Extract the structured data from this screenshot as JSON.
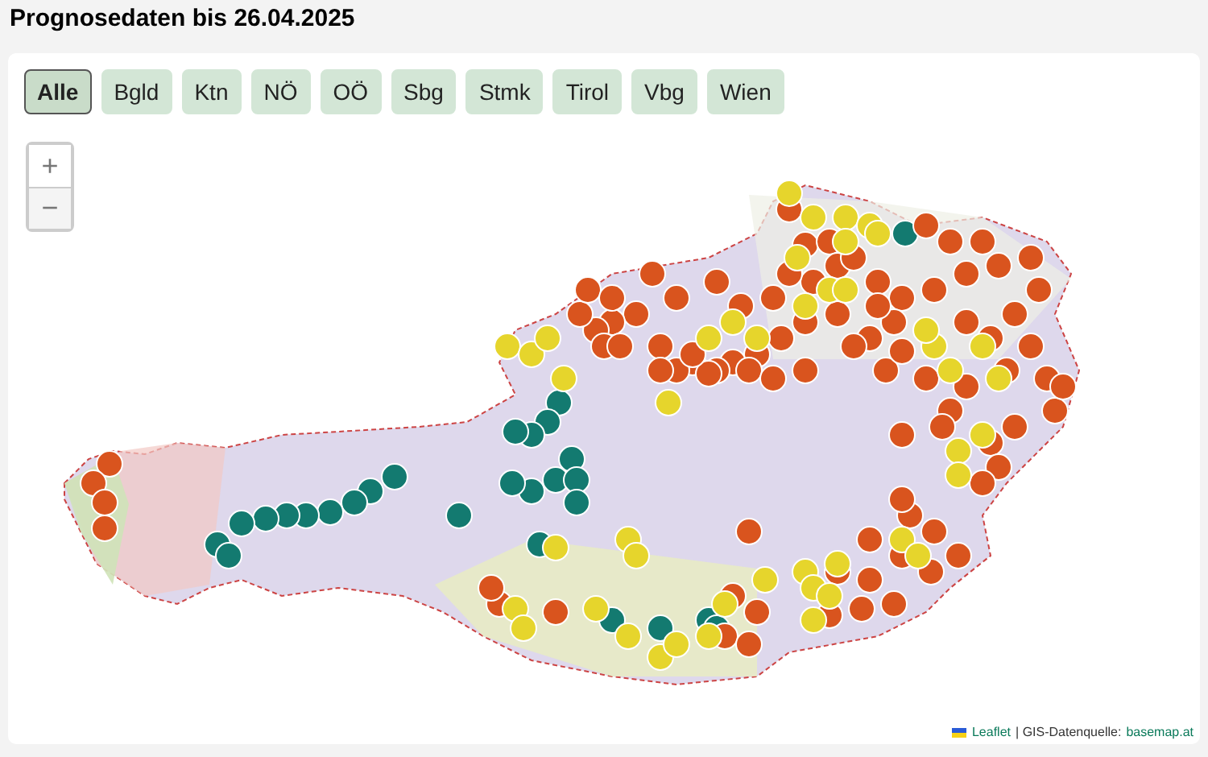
{
  "title": "Prognosedaten bis 26.04.2025",
  "filters": [
    {
      "label": "Alle",
      "selected": true
    },
    {
      "label": "Bgld",
      "selected": false
    },
    {
      "label": "Ktn",
      "selected": false
    },
    {
      "label": "NÖ",
      "selected": false
    },
    {
      "label": "OÖ",
      "selected": false
    },
    {
      "label": "Sbg",
      "selected": false
    },
    {
      "label": "Stmk",
      "selected": false
    },
    {
      "label": "Tirol",
      "selected": false
    },
    {
      "label": "Vbg",
      "selected": false
    },
    {
      "label": "Wien",
      "selected": false
    }
  ],
  "zoom": {
    "in": "+",
    "out": "−"
  },
  "attribution": {
    "library": "Leaflet",
    "separator": "| GIS-Datenquelle:",
    "source": "basemap.at"
  }
}
